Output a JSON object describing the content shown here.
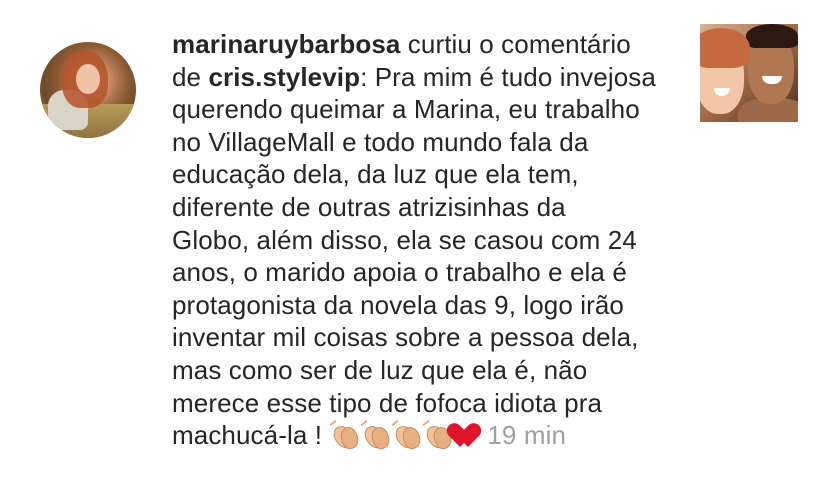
{
  "notification": {
    "actor_username": "marinaruybarbosa",
    "action_text": " curtiu o comentário",
    "preposition": "de ",
    "commenter_username": "cris.stylevip",
    "comment_lines": [
      ": Pra mim é tudo invejosa",
      "querendo queimar a Marina, eu trabalho",
      "no VillageMall e todo mundo fala da",
      "educação dela, da luz que ela tem,",
      "diferente de outras atrizisinhas da",
      "Globo, além disso, ela se casou com 24",
      "anos, o marido apoia o trabalho e ela é",
      "protagonista da novela das 9, logo irão",
      "inventar mil coisas sobre a pessoa dela,",
      "mas como ser de luz que ela é, não",
      "merece esse tipo de fofoca idiota pra"
    ],
    "last_line_text": "machucá-la ! ",
    "emojis": [
      "clapping-hands",
      "clapping-hands",
      "clapping-hands",
      "clapping-hands",
      "red-heart"
    ],
    "timestamp": "19 min"
  },
  "colors": {
    "text": "#262626",
    "muted": "#a0a0a0",
    "heart": "#e0142a",
    "background": "#ffffff"
  }
}
